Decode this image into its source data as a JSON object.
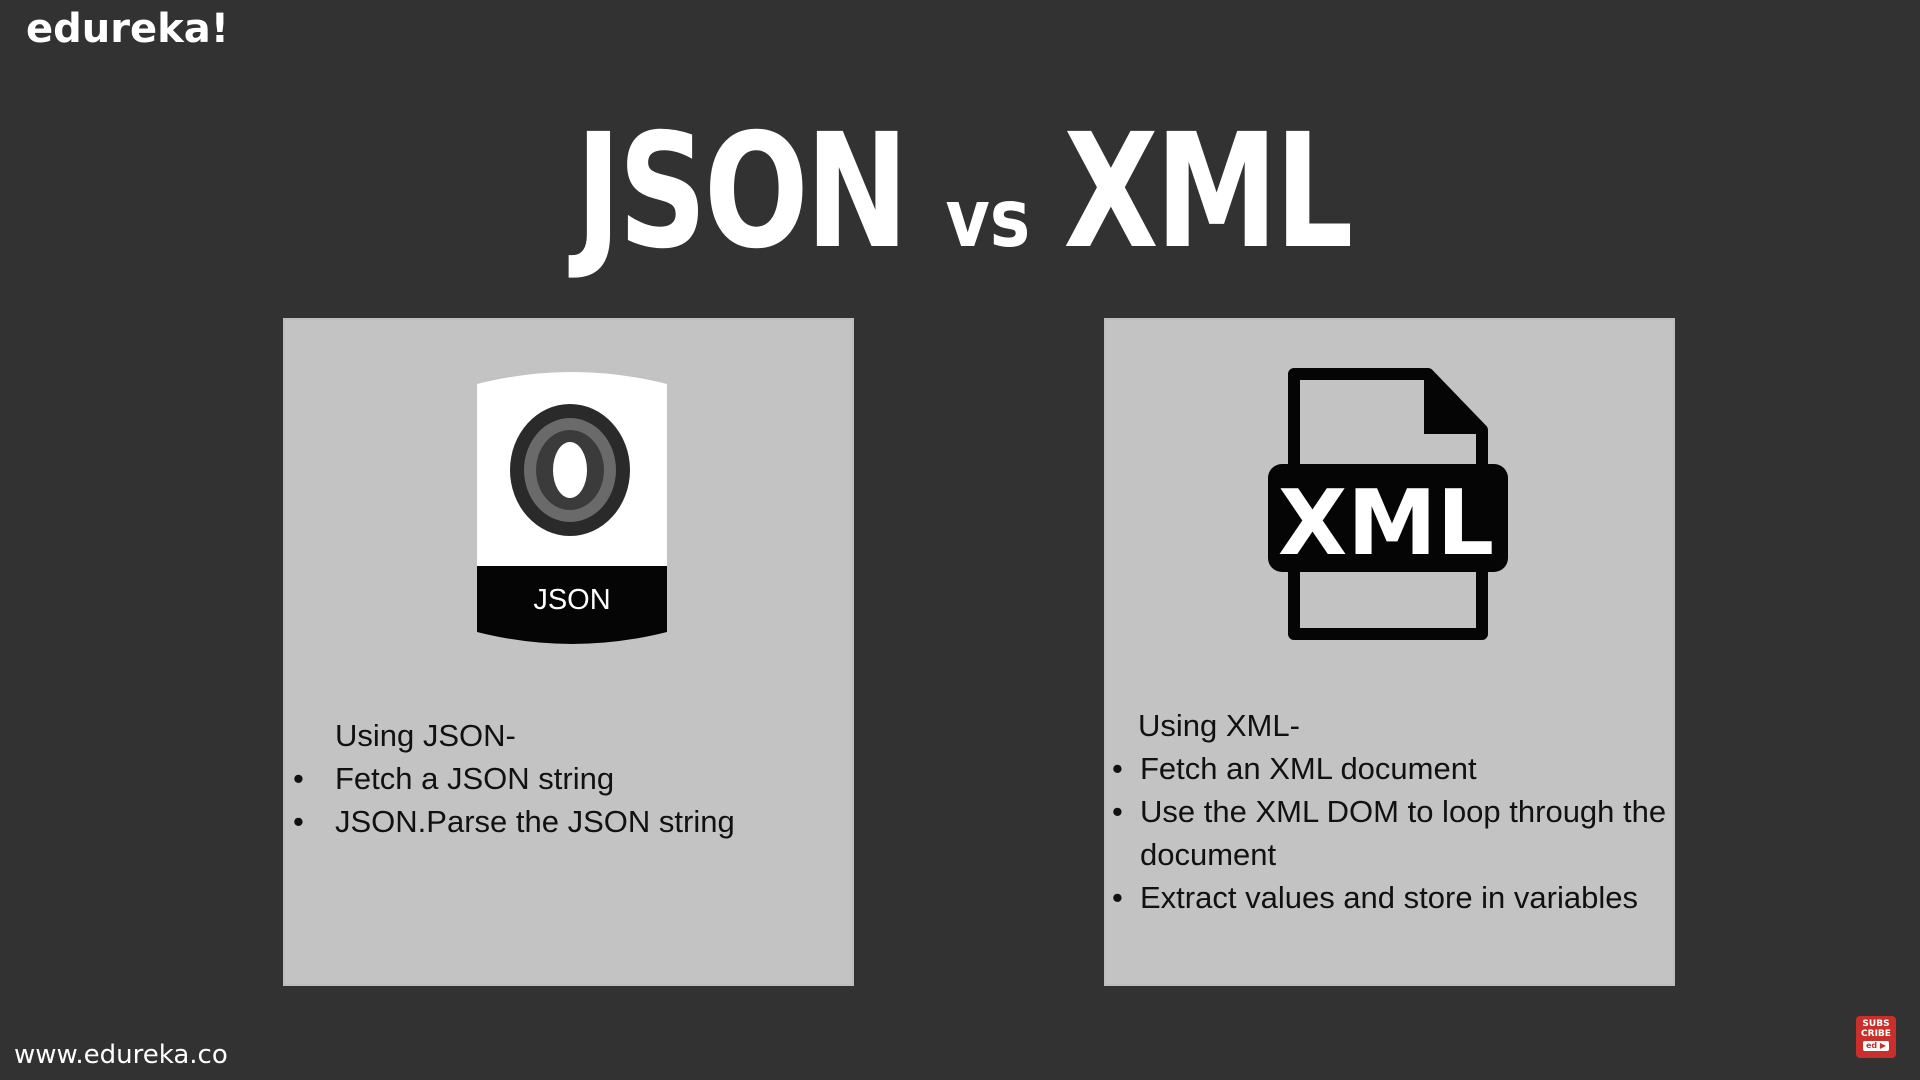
{
  "brand": "edureka!",
  "footer_url": "www.edureka.co",
  "title": {
    "left": "JSON",
    "vs": "vs",
    "right": "XML"
  },
  "json_card": {
    "logo_label": "JSON",
    "heading": "Using JSON-",
    "bullets": [
      "Fetch a JSON string",
      "JSON.Parse the JSON string"
    ]
  },
  "xml_card": {
    "logo_label": "XML",
    "heading": "Using XML-",
    "bullets": [
      "Fetch an XML document",
      "Use the XML DOM to loop through the document",
      "Extract values and store in variables"
    ]
  },
  "subscribe": {
    "line1": "SUBS",
    "line2": "CRIBE",
    "badge": "ed ▶"
  },
  "colors": {
    "background": "#323232",
    "card": "#c3c3c3",
    "text_light": "#ffffff",
    "text_dark": "#111111"
  }
}
